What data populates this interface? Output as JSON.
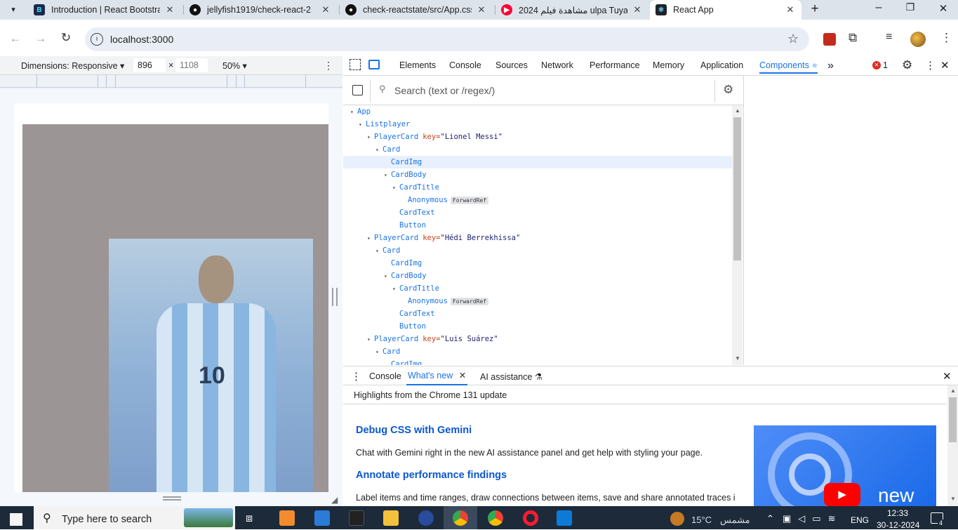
{
  "browser": {
    "tabs": [
      {
        "title": "Introduction | React Bootstra",
        "icon": "react-bootstrap-icon",
        "color": "#41e0fd"
      },
      {
        "title": "jellyfish1919/check-react-2",
        "icon": "github-icon",
        "color": "#111111"
      },
      {
        "title": "check-reactstate/src/App.css",
        "icon": "github-icon",
        "color": "#111111"
      },
      {
        "title": "مشاهدة فيلم 2024 ulpa Tuya",
        "icon": "youtube-icon",
        "color": "#ff0033"
      },
      {
        "title": "React App",
        "icon": "react-icon",
        "color": "#61dafb"
      }
    ],
    "url": "localhost:3000"
  },
  "device_toolbar": {
    "dimensions_label": "Dimensions: Responsive",
    "width": "896",
    "times": "×",
    "height": "1108",
    "zoom": "50%"
  },
  "devtools": {
    "tabs": [
      "Elements",
      "Console",
      "Sources",
      "Network",
      "Performance",
      "Memory",
      "Application",
      "Components"
    ],
    "active_tab": "Components",
    "more": "»",
    "error_count": "1",
    "search_placeholder": "Search (text or /regex/)",
    "tree": [
      {
        "indent": 0,
        "name": "App",
        "arrow": "▾"
      },
      {
        "indent": 1,
        "name": "Listplayer",
        "arrow": "▾"
      },
      {
        "indent": 2,
        "name": "PlayerCard",
        "arrow": "▾",
        "key": "key=",
        "value": "\"Lionel Messi\""
      },
      {
        "indent": 3,
        "name": "Card",
        "arrow": "▾"
      },
      {
        "indent": 4,
        "name": "CardImg",
        "arrow": "",
        "selected": true
      },
      {
        "indent": 4,
        "name": "CardBody",
        "arrow": "▾"
      },
      {
        "indent": 5,
        "name": "CardTitle",
        "arrow": "▾"
      },
      {
        "indent": 6,
        "name": "Anonymous",
        "arrow": "",
        "badge": "ForwardRef"
      },
      {
        "indent": 5,
        "name": "CardText",
        "arrow": ""
      },
      {
        "indent": 5,
        "name": "Button",
        "arrow": ""
      },
      {
        "indent": 2,
        "name": "PlayerCard",
        "arrow": "▾",
        "key": "key=",
        "value": "\"Hédi Berrekhissa\""
      },
      {
        "indent": 3,
        "name": "Card",
        "arrow": "▾"
      },
      {
        "indent": 4,
        "name": "CardImg",
        "arrow": ""
      },
      {
        "indent": 4,
        "name": "CardBody",
        "arrow": "▾"
      },
      {
        "indent": 5,
        "name": "CardTitle",
        "arrow": "▾"
      },
      {
        "indent": 6,
        "name": "Anonymous",
        "arrow": "",
        "badge": "ForwardRef"
      },
      {
        "indent": 5,
        "name": "CardText",
        "arrow": ""
      },
      {
        "indent": 5,
        "name": "Button",
        "arrow": ""
      },
      {
        "indent": 2,
        "name": "PlayerCard",
        "arrow": "▾",
        "key": "key=",
        "value": "\"Luis Suárez\""
      },
      {
        "indent": 3,
        "name": "Card",
        "arrow": "▾"
      },
      {
        "indent": 4,
        "name": "CardImg",
        "arrow": ""
      }
    ]
  },
  "drawer": {
    "tabs": [
      "Console",
      "What's new",
      "AI assistance"
    ],
    "active_tab": "What's new",
    "highlights": "Highlights from the Chrome 131 update",
    "h1": "Debug CSS with Gemini",
    "p1": "Chat with Gemini right in the new AI assistance panel and get help with styling your page.",
    "h2": "Annotate performance findings",
    "p2": "Label items and time ranges, draw connections between items, save and share annotated traces in",
    "video_label": "new"
  },
  "taskbar": {
    "search_placeholder": "Type here to search",
    "weather": "15°C",
    "weather_text": "مشمس",
    "lang": "ENG",
    "time": "12:33",
    "date": "30-12-2024",
    "notifications": "4"
  }
}
